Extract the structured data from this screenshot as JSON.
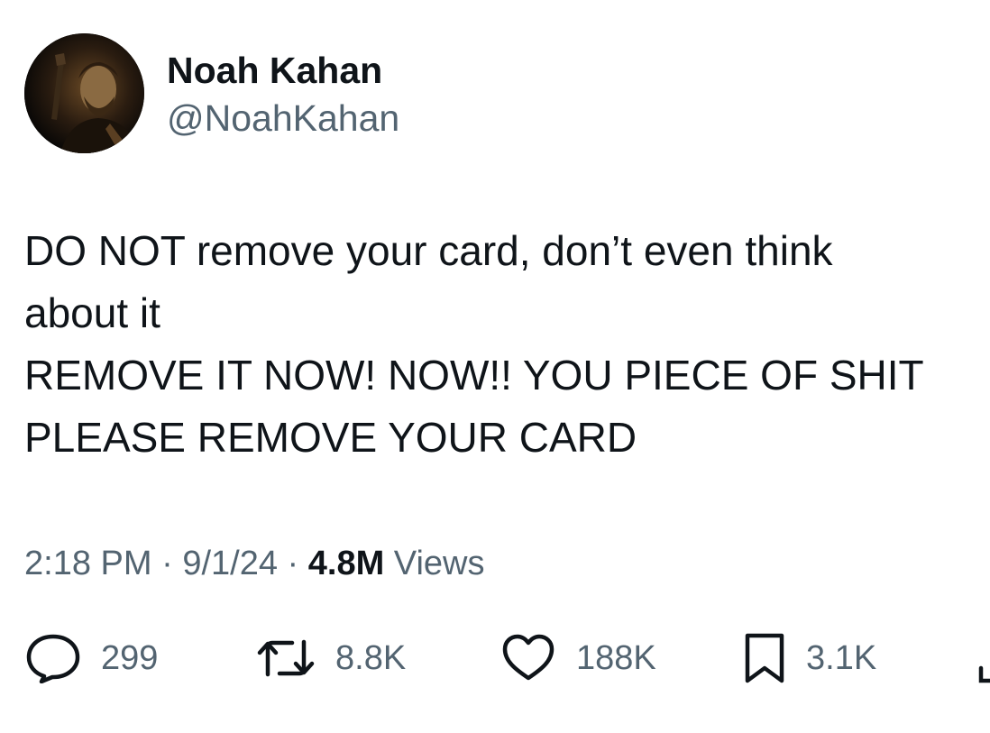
{
  "author": {
    "display_name": "Noah Kahan",
    "handle": "@NoahKahan"
  },
  "tweet": {
    "lines": [
      "DO NOT remove your card, don’t even think",
      "about it",
      "REMOVE IT NOW! NOW!! YOU PIECE OF SHIT",
      "PLEASE REMOVE YOUR CARD"
    ]
  },
  "meta": {
    "time": "2:18 PM",
    "separator": "·",
    "date": "9/1/24",
    "views_count": "4.8M",
    "views_label": "Views"
  },
  "actions": {
    "replies": "299",
    "reposts": "8.8K",
    "likes": "188K",
    "bookmarks": "3.1K"
  },
  "icons": {
    "reply": "speech-bubble-icon",
    "repost": "repost-arrows-icon",
    "like": "heart-icon",
    "bookmark": "bookmark-icon",
    "share": "share-icon"
  },
  "colors": {
    "text_primary": "#0f1419",
    "text_secondary": "#536471",
    "background": "#ffffff"
  }
}
